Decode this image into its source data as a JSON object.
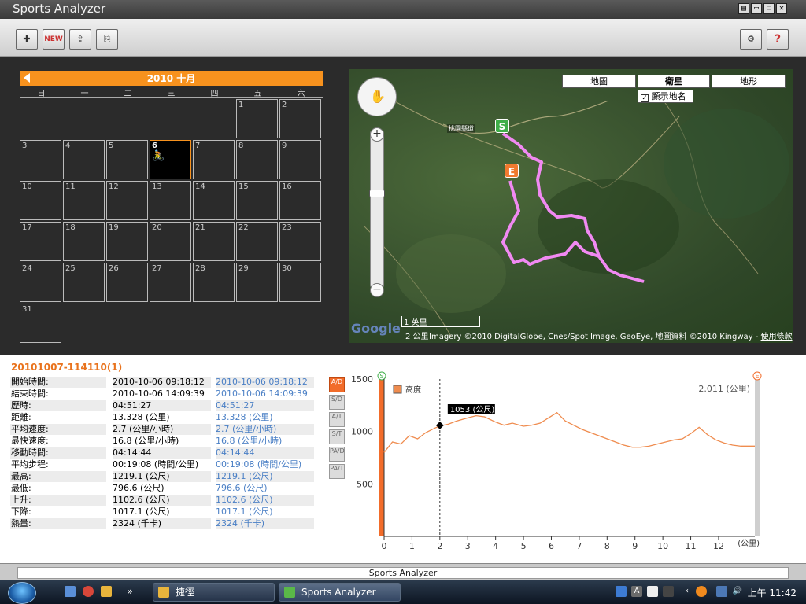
{
  "window": {
    "title": "Sports Analyzer",
    "controls": [
      "▤",
      "▭",
      "❐",
      "✕"
    ]
  },
  "toolbar": {
    "left_buttons": [
      {
        "name": "import-button",
        "glyph": "✚"
      },
      {
        "name": "new-button",
        "glyph": "NEW"
      },
      {
        "name": "export-button",
        "glyph": "⇪"
      },
      {
        "name": "save-button",
        "glyph": "⎘"
      }
    ],
    "right_buttons": [
      {
        "name": "device-button",
        "glyph": "⚙"
      },
      {
        "name": "help-button",
        "glyph": "?"
      }
    ]
  },
  "calendar": {
    "month_label": "2010 十月",
    "weekdays": [
      "日",
      "一",
      "二",
      "三",
      "四",
      "五",
      "六"
    ],
    "first_weekday": 5,
    "days": 31,
    "active_day": 6,
    "activity_icon": "🚴"
  },
  "map": {
    "types": [
      "地圖",
      "衛星",
      "地形"
    ],
    "selected_type": "衛星",
    "show_names_label": "顯示地名",
    "show_names_checked": true,
    "start_marker": "S",
    "end_marker": "E",
    "road_label": "桃園縣道",
    "scale_mi": "1 英里",
    "scale_km": "2 公里",
    "google": "Google",
    "copyright": "Imagery ©2010 DigitalGlobe, Cnes/Spot Image, GeoEye, 地圖資料 ©2010 Kingway -",
    "terms_link": "使用條款",
    "pan_icon": "✋",
    "zoom_in": "+",
    "zoom_out": "−"
  },
  "route": {
    "title": "20101007-114110(1)",
    "stats": [
      {
        "label": "開始時間:",
        "value": "2010-10-06 09:18:12",
        "compare": "2010-10-06 09:18:12"
      },
      {
        "label": "結束時間:",
        "value": "2010-10-06 14:09:39",
        "compare": "2010-10-06 14:09:39"
      },
      {
        "label": "歷時:",
        "value": "04:51:27",
        "compare": "04:51:27"
      },
      {
        "label": "距離:",
        "value": "13.328 (公里)",
        "compare": "13.328 (公里)"
      },
      {
        "label": "平均速度:",
        "value": "2.7 (公里/小時)",
        "compare": "2.7 (公里/小時)"
      },
      {
        "label": "最快速度:",
        "value": "16.8 (公里/小時)",
        "compare": "16.8 (公里/小時)"
      },
      {
        "label": "移動時間:",
        "value": "04:14:44",
        "compare": "04:14:44"
      },
      {
        "label": "平均步程:",
        "value": "00:19:08 (時間/公里)",
        "compare": "00:19:08 (時間/公里)"
      },
      {
        "label": "最高:",
        "value": "1219.1 (公尺)",
        "compare": "1219.1 (公尺)"
      },
      {
        "label": "最低:",
        "value": "796.6 (公尺)",
        "compare": "796.6 (公尺)"
      },
      {
        "label": "上升:",
        "value": "1102.6 (公尺)",
        "compare": "1102.6 (公尺)"
      },
      {
        "label": "下降:",
        "value": "1017.1 (公尺)",
        "compare": "1017.1 (公尺)"
      },
      {
        "label": "熱量:",
        "value": "2324 (千卡)",
        "compare": "2324 (千卡)"
      }
    ]
  },
  "chart_modes": [
    {
      "name": "mode-altitude-distance",
      "label": "A/D",
      "active": true
    },
    {
      "name": "mode-speed-distance",
      "label": "S/D",
      "active": false
    },
    {
      "name": "mode-altitude-time",
      "label": "A/T",
      "active": false
    },
    {
      "name": "mode-speed-time",
      "label": "S/T",
      "active": false
    },
    {
      "name": "mode-pace-distance",
      "label": "PA/D",
      "active": false
    },
    {
      "name": "mode-pace-time",
      "label": "PA/T",
      "active": false
    }
  ],
  "chart_data": {
    "type": "line",
    "legend": "高度",
    "distance_readout": "2.011 (公里)",
    "tooltip": "1053 (公尺)",
    "cursor_x": 2.0,
    "x_unit": "(公里)",
    "xlim": [
      0,
      13.3
    ],
    "ylim": [
      0,
      1500
    ],
    "x_ticks": [
      0,
      1,
      2,
      3,
      4,
      5,
      6,
      7,
      8,
      9,
      10,
      11,
      12
    ],
    "y_ticks": [
      500,
      1000,
      1500
    ],
    "start_marker": "S",
    "end_marker": "E",
    "x": [
      0,
      0.3,
      0.6,
      0.9,
      1.2,
      1.5,
      1.8,
      2.0,
      2.3,
      2.6,
      3.0,
      3.3,
      3.6,
      4.0,
      4.3,
      4.6,
      5.0,
      5.3,
      5.6,
      5.9,
      6.2,
      6.5,
      6.8,
      7.1,
      7.4,
      7.7,
      8.0,
      8.3,
      8.6,
      8.9,
      9.2,
      9.5,
      9.8,
      10.1,
      10.4,
      10.7,
      11.0,
      11.3,
      11.6,
      11.9,
      12.2,
      12.5,
      12.8,
      13.1,
      13.3
    ],
    "values": [
      800,
      900,
      880,
      960,
      930,
      990,
      1030,
      1053,
      1070,
      1100,
      1130,
      1150,
      1140,
      1090,
      1060,
      1080,
      1050,
      1060,
      1080,
      1130,
      1180,
      1100,
      1060,
      1020,
      990,
      960,
      930,
      900,
      870,
      850,
      850,
      860,
      880,
      900,
      920,
      930,
      980,
      1040,
      970,
      920,
      890,
      870,
      860,
      860,
      860
    ]
  },
  "statusbar": {
    "text": "Sports Analyzer"
  },
  "taskbar": {
    "tasks": [
      {
        "label": "捷徑"
      },
      {
        "label": "Sports Analyzer"
      }
    ],
    "clock": "上午 11:42"
  }
}
